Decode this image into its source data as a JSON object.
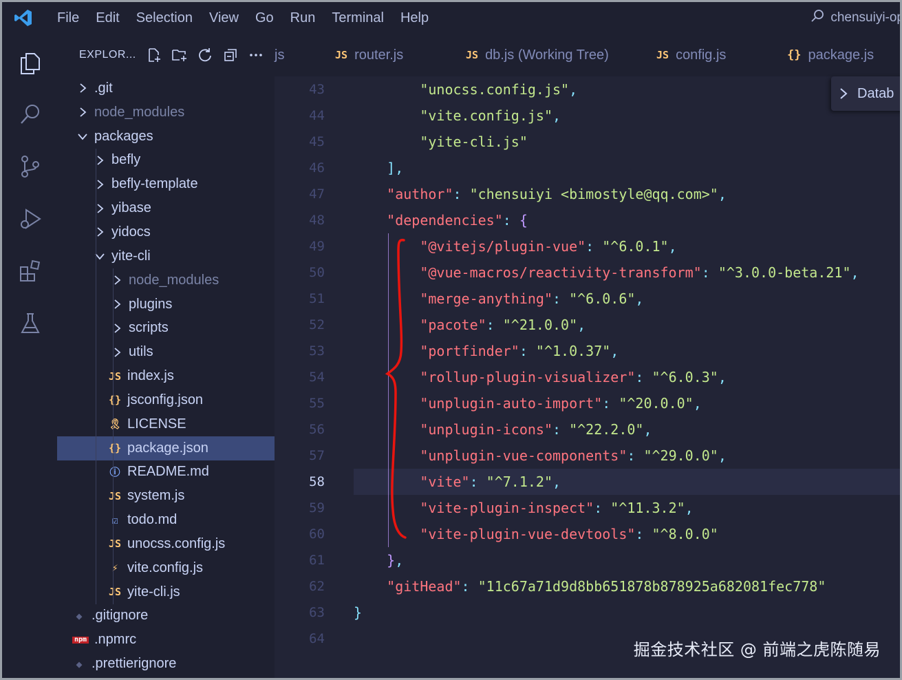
{
  "menu": [
    "File",
    "Edit",
    "Selection",
    "View",
    "Go",
    "Run",
    "Terminal",
    "Help"
  ],
  "title_search": "chensuiyi-op",
  "explorer": {
    "title": "EXPLOR...",
    "tree": [
      {
        "label": ".git",
        "type": "folder",
        "depth": 0,
        "open": false
      },
      {
        "label": "node_modules",
        "type": "folder",
        "depth": 0,
        "open": false,
        "dim": true
      },
      {
        "label": "packages",
        "type": "folder",
        "depth": 0,
        "open": true
      },
      {
        "label": "befly",
        "type": "folder",
        "depth": 1,
        "open": false
      },
      {
        "label": "befly-template",
        "type": "folder",
        "depth": 1,
        "open": false
      },
      {
        "label": "yibase",
        "type": "folder",
        "depth": 1,
        "open": false
      },
      {
        "label": "yidocs",
        "type": "folder",
        "depth": 1,
        "open": false
      },
      {
        "label": "yite-cli",
        "type": "folder",
        "depth": 1,
        "open": true
      },
      {
        "label": "node_modules",
        "type": "folder",
        "depth": 2,
        "open": false,
        "dim": true
      },
      {
        "label": "plugins",
        "type": "folder",
        "depth": 2,
        "open": false
      },
      {
        "label": "scripts",
        "type": "folder",
        "depth": 2,
        "open": false
      },
      {
        "label": "utils",
        "type": "folder",
        "depth": 2,
        "open": false
      },
      {
        "label": "index.js",
        "type": "js",
        "depth": 2
      },
      {
        "label": "jsconfig.json",
        "type": "json",
        "depth": 2
      },
      {
        "label": "LICENSE",
        "type": "license",
        "depth": 2
      },
      {
        "label": "package.json",
        "type": "json",
        "depth": 2,
        "selected": true
      },
      {
        "label": "README.md",
        "type": "info",
        "depth": 2
      },
      {
        "label": "system.js",
        "type": "js",
        "depth": 2
      },
      {
        "label": "todo.md",
        "type": "todo",
        "depth": 2
      },
      {
        "label": "unocss.config.js",
        "type": "js",
        "depth": 2
      },
      {
        "label": "vite.config.js",
        "type": "vite",
        "depth": 2
      },
      {
        "label": "yite-cli.js",
        "type": "js",
        "depth": 2
      },
      {
        "label": ".gitignore",
        "type": "git",
        "depth": 0
      },
      {
        "label": ".npmrc",
        "type": "npm",
        "depth": 0
      },
      {
        "label": ".prettierignore",
        "type": "git",
        "depth": 0
      }
    ]
  },
  "tabs": [
    {
      "label": "js",
      "icon": ""
    },
    {
      "label": "router.js",
      "icon": "JS"
    },
    {
      "label": "db.js (Working Tree)",
      "icon": "JS"
    },
    {
      "label": "config.js",
      "icon": "JS"
    },
    {
      "label": "package.js",
      "icon": "{}"
    }
  ],
  "breadcrumb_popup": "Datab",
  "editor": {
    "active_line": 58,
    "lines": [
      {
        "n": 43,
        "tokens": [
          [
            "        ",
            ""
          ],
          [
            "\"unocss.config.js\"",
            "str"
          ],
          [
            ",",
            "punc"
          ]
        ]
      },
      {
        "n": 44,
        "tokens": [
          [
            "        ",
            ""
          ],
          [
            "\"vite.config.js\"",
            "str"
          ],
          [
            ",",
            "punc"
          ]
        ]
      },
      {
        "n": 45,
        "tokens": [
          [
            "        ",
            ""
          ],
          [
            "\"yite-cli.js\"",
            "str"
          ]
        ]
      },
      {
        "n": 46,
        "tokens": [
          [
            "    ",
            ""
          ],
          [
            "],",
            "punc"
          ]
        ]
      },
      {
        "n": 47,
        "tokens": [
          [
            "    ",
            ""
          ],
          [
            "\"author\"",
            "key"
          ],
          [
            ": ",
            "punc"
          ],
          [
            "\"chensuiyi <bimostyle@qq.com>\"",
            "str"
          ],
          [
            ",",
            "punc"
          ]
        ]
      },
      {
        "n": 48,
        "tokens": [
          [
            "    ",
            ""
          ],
          [
            "\"dependencies\"",
            "key"
          ],
          [
            ": ",
            "punc"
          ],
          [
            "{",
            "brace"
          ]
        ]
      },
      {
        "n": 49,
        "tokens": [
          [
            "        ",
            ""
          ],
          [
            "\"@vitejs/plugin-vue\"",
            "key"
          ],
          [
            ": ",
            "punc"
          ],
          [
            "\"^6.0.1\"",
            "str"
          ],
          [
            ",",
            "punc"
          ]
        ]
      },
      {
        "n": 50,
        "tokens": [
          [
            "        ",
            ""
          ],
          [
            "\"@vue-macros/reactivity-transform\"",
            "key"
          ],
          [
            ": ",
            "punc"
          ],
          [
            "\"^3.0.0-beta.21\"",
            "str"
          ],
          [
            ",",
            "punc"
          ]
        ]
      },
      {
        "n": 51,
        "tokens": [
          [
            "        ",
            ""
          ],
          [
            "\"merge-anything\"",
            "key"
          ],
          [
            ": ",
            "punc"
          ],
          [
            "\"^6.0.6\"",
            "str"
          ],
          [
            ",",
            "punc"
          ]
        ]
      },
      {
        "n": 52,
        "tokens": [
          [
            "        ",
            ""
          ],
          [
            "\"pacote\"",
            "key"
          ],
          [
            ": ",
            "punc"
          ],
          [
            "\"^21.0.0\"",
            "str"
          ],
          [
            ",",
            "punc"
          ]
        ]
      },
      {
        "n": 53,
        "tokens": [
          [
            "        ",
            ""
          ],
          [
            "\"portfinder\"",
            "key"
          ],
          [
            ": ",
            "punc"
          ],
          [
            "\"^1.0.37\"",
            "str"
          ],
          [
            ",",
            "punc"
          ]
        ]
      },
      {
        "n": 54,
        "tokens": [
          [
            "        ",
            ""
          ],
          [
            "\"rollup-plugin-visualizer\"",
            "key"
          ],
          [
            ": ",
            "punc"
          ],
          [
            "\"^6.0.3\"",
            "str"
          ],
          [
            ",",
            "punc"
          ]
        ]
      },
      {
        "n": 55,
        "tokens": [
          [
            "        ",
            ""
          ],
          [
            "\"unplugin-auto-import\"",
            "key"
          ],
          [
            ": ",
            "punc"
          ],
          [
            "\"^20.0.0\"",
            "str"
          ],
          [
            ",",
            "punc"
          ]
        ]
      },
      {
        "n": 56,
        "tokens": [
          [
            "        ",
            ""
          ],
          [
            "\"unplugin-icons\"",
            "key"
          ],
          [
            ": ",
            "punc"
          ],
          [
            "\"^22.2.0\"",
            "str"
          ],
          [
            ",",
            "punc"
          ]
        ]
      },
      {
        "n": 57,
        "tokens": [
          [
            "        ",
            ""
          ],
          [
            "\"unplugin-vue-components\"",
            "key"
          ],
          [
            ": ",
            "punc"
          ],
          [
            "\"^29.0.0\"",
            "str"
          ],
          [
            ",",
            "punc"
          ]
        ]
      },
      {
        "n": 58,
        "tokens": [
          [
            "        ",
            ""
          ],
          [
            "\"vite\"",
            "key"
          ],
          [
            ": ",
            "punc"
          ],
          [
            "\"^7.1.2\"",
            "str"
          ],
          [
            ",",
            "punc"
          ]
        ]
      },
      {
        "n": 59,
        "tokens": [
          [
            "        ",
            ""
          ],
          [
            "\"vite-plugin-inspect\"",
            "key"
          ],
          [
            ": ",
            "punc"
          ],
          [
            "\"^11.3.2\"",
            "str"
          ],
          [
            ",",
            "punc"
          ]
        ]
      },
      {
        "n": 60,
        "tokens": [
          [
            "        ",
            ""
          ],
          [
            "\"vite-plugin-vue-devtools\"",
            "key"
          ],
          [
            ": ",
            "punc"
          ],
          [
            "\"^8.0.0\"",
            "str"
          ]
        ]
      },
      {
        "n": 61,
        "tokens": [
          [
            "    ",
            ""
          ],
          [
            "}",
            "brace"
          ],
          [
            ",",
            "punc"
          ]
        ]
      },
      {
        "n": 62,
        "tokens": [
          [
            "    ",
            ""
          ],
          [
            "\"gitHead\"",
            "key"
          ],
          [
            ": ",
            "punc"
          ],
          [
            "\"11c67a71d9d8bb651878b878925a682081fec778\"",
            "str"
          ]
        ]
      },
      {
        "n": 63,
        "tokens": [
          [
            "}",
            "punc"
          ]
        ]
      },
      {
        "n": 64,
        "tokens": []
      }
    ]
  },
  "watermark": "掘金技术社区 @ 前端之虎陈随易",
  "colors": {
    "accent_js": "#ffc777",
    "annotation_red": "#e8150f",
    "selection": "#3b4a7a"
  }
}
